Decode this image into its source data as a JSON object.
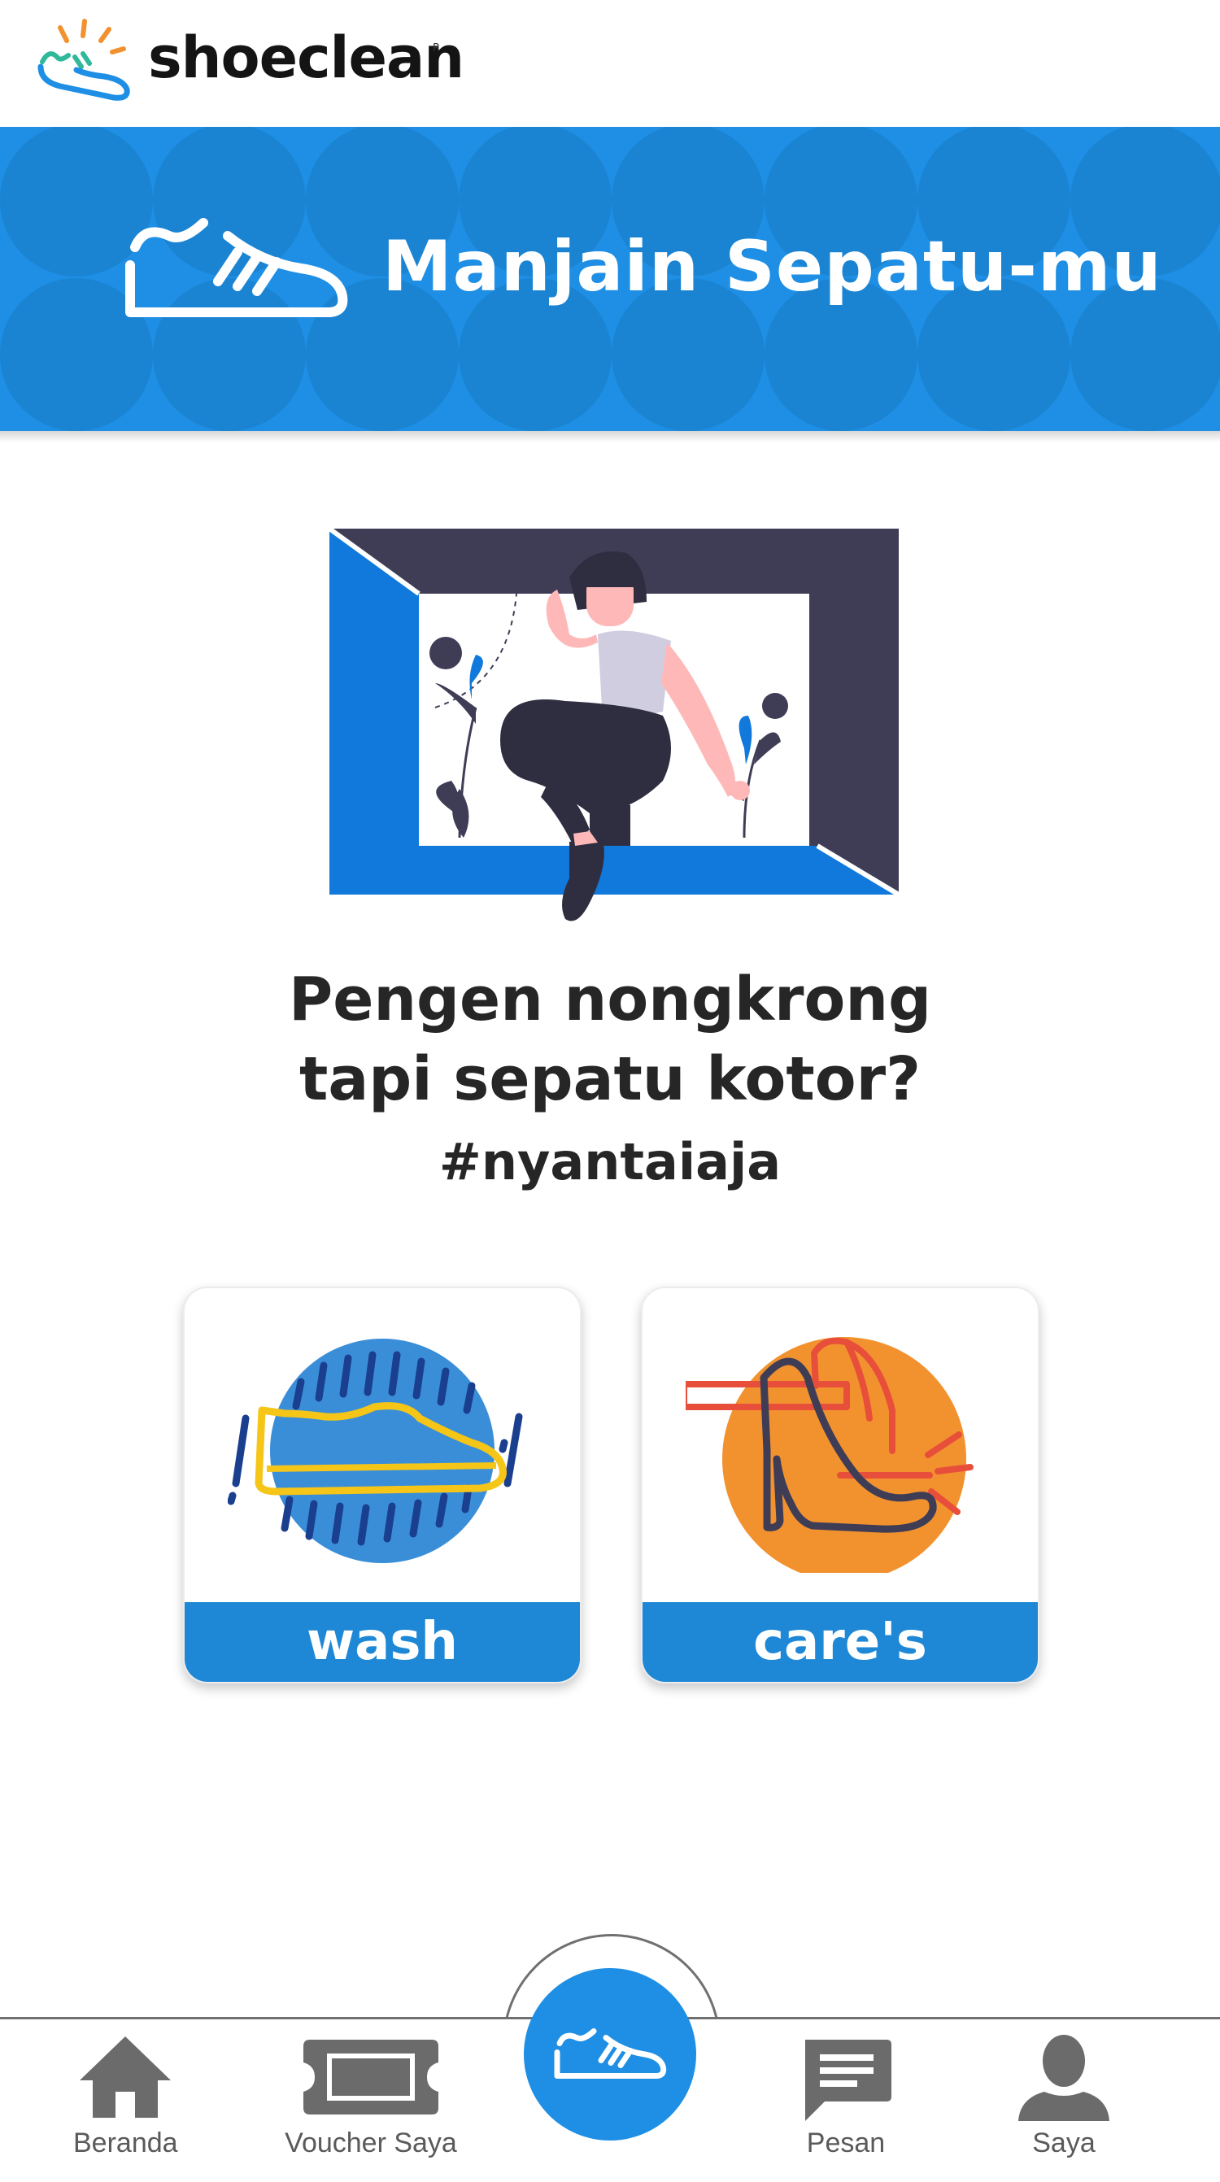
{
  "header": {
    "brand": "shoeclean",
    "reg_mark": "R"
  },
  "banner": {
    "title": "Manjain Sepatu-mu"
  },
  "hero": {
    "line1": "Pengen nongkrong",
    "line2": "tapi sepatu kotor?",
    "hashtag": "#nyantaiaja"
  },
  "services": [
    {
      "label": "wash"
    },
    {
      "label": "care's"
    }
  ],
  "bottom_nav": {
    "items": [
      {
        "label": "Beranda"
      },
      {
        "label": "Voucher Saya"
      },
      {
        "label": "Pesan"
      },
      {
        "label": "Saya"
      }
    ]
  },
  "colors": {
    "primary": "#1e8fe4",
    "card_label": "#1e88d6",
    "care_orange": "#f2922f",
    "wash_yellow": "#f5c518",
    "text_dark": "#262626",
    "nav_gray": "#6b6b6b"
  }
}
